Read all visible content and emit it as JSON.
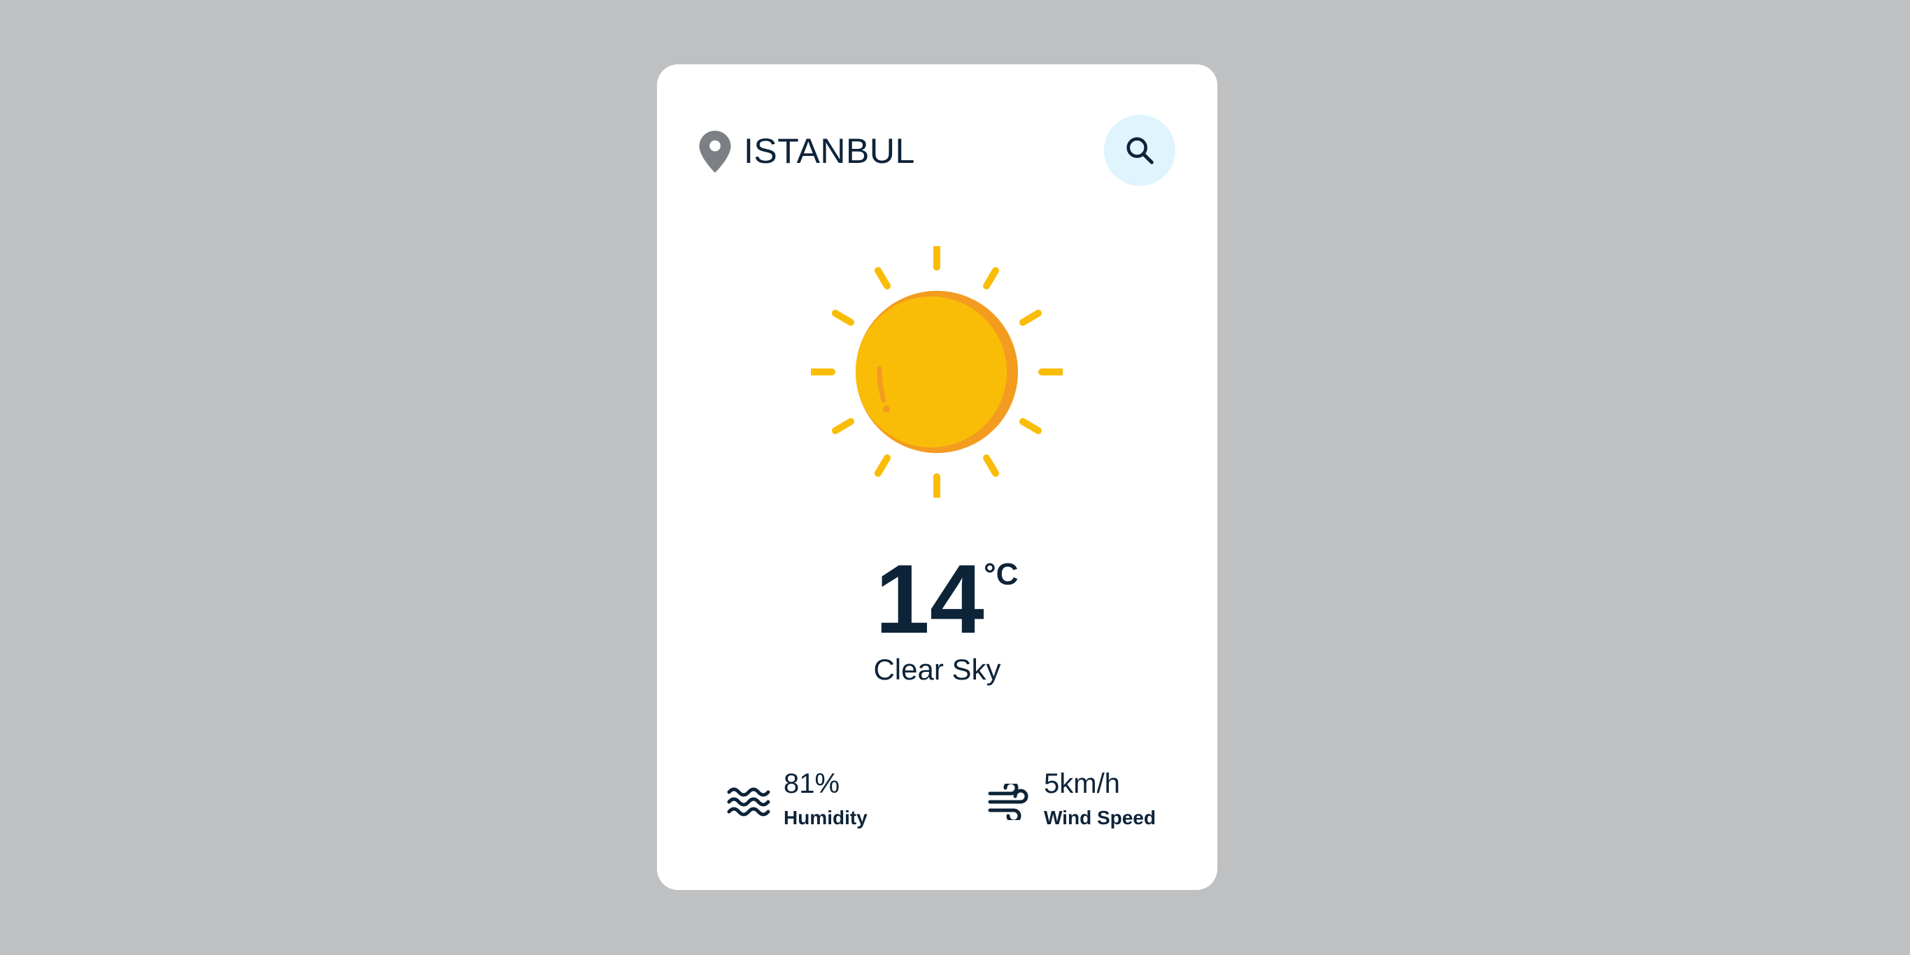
{
  "location": {
    "city": "ISTANBUL",
    "icon": "map-pin-icon"
  },
  "search": {
    "icon": "search-icon"
  },
  "weather": {
    "icon": "sun-icon",
    "temperature": "14",
    "unit": "°C",
    "condition": "Clear Sky"
  },
  "stats": {
    "humidity": {
      "value": "81%",
      "label": "Humidity",
      "icon": "waves-icon"
    },
    "wind": {
      "value": "5km/h",
      "label": "Wind Speed",
      "icon": "wind-icon"
    }
  },
  "colors": {
    "background": "#bfc0c2",
    "card": "#ffffff",
    "text": "#0d2338",
    "search_bg": "#dff4fd",
    "sun": "#f9bd08",
    "sun_shade": "#f39c1f"
  }
}
